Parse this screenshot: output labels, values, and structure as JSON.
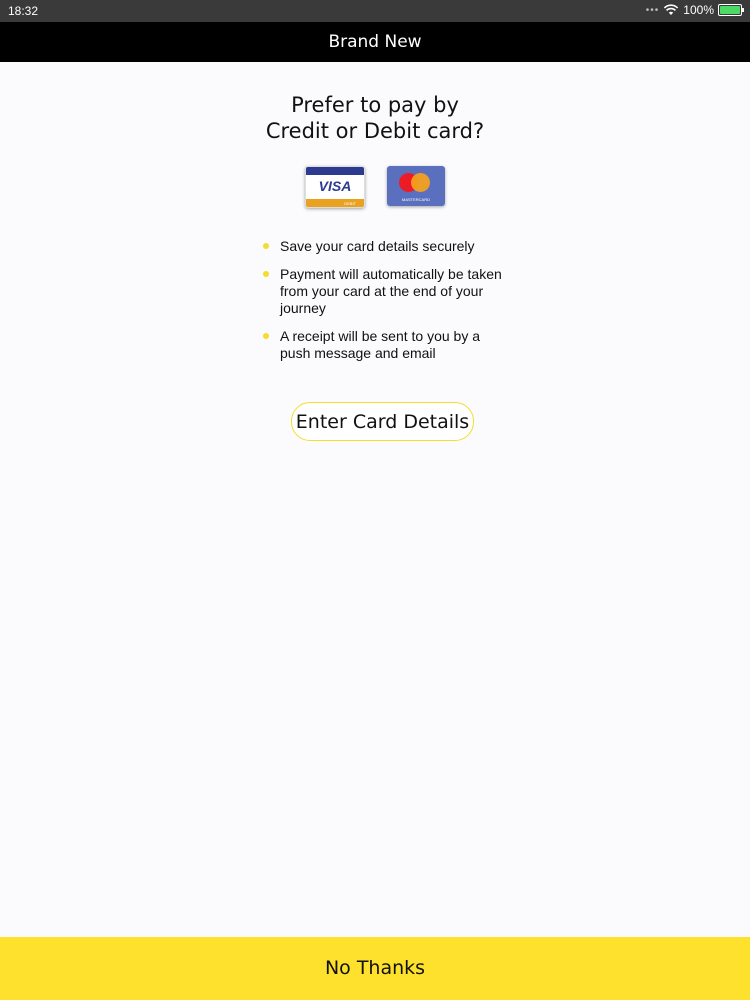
{
  "status_bar": {
    "time": "18:32",
    "battery_percent": "100%"
  },
  "nav": {
    "title": "Brand New"
  },
  "headline": {
    "line1": "Prefer to pay by",
    "line2": "Credit or Debit card?"
  },
  "cards": {
    "visa": {
      "brand_text": "VISA",
      "type_text": "DEBIT"
    },
    "mastercard": {
      "label_text": "MASTERCARD"
    }
  },
  "bullets": [
    "Save your card details securely",
    "Payment will automatically be taken from your card at the end of your journey",
    "A receipt will be sent to you by a push message and email"
  ],
  "buttons": {
    "enter_card_details": "Enter Card Details",
    "no_thanks": "No Thanks"
  },
  "colors": {
    "accent_yellow": "#fde12d",
    "nav_black": "#000000"
  }
}
